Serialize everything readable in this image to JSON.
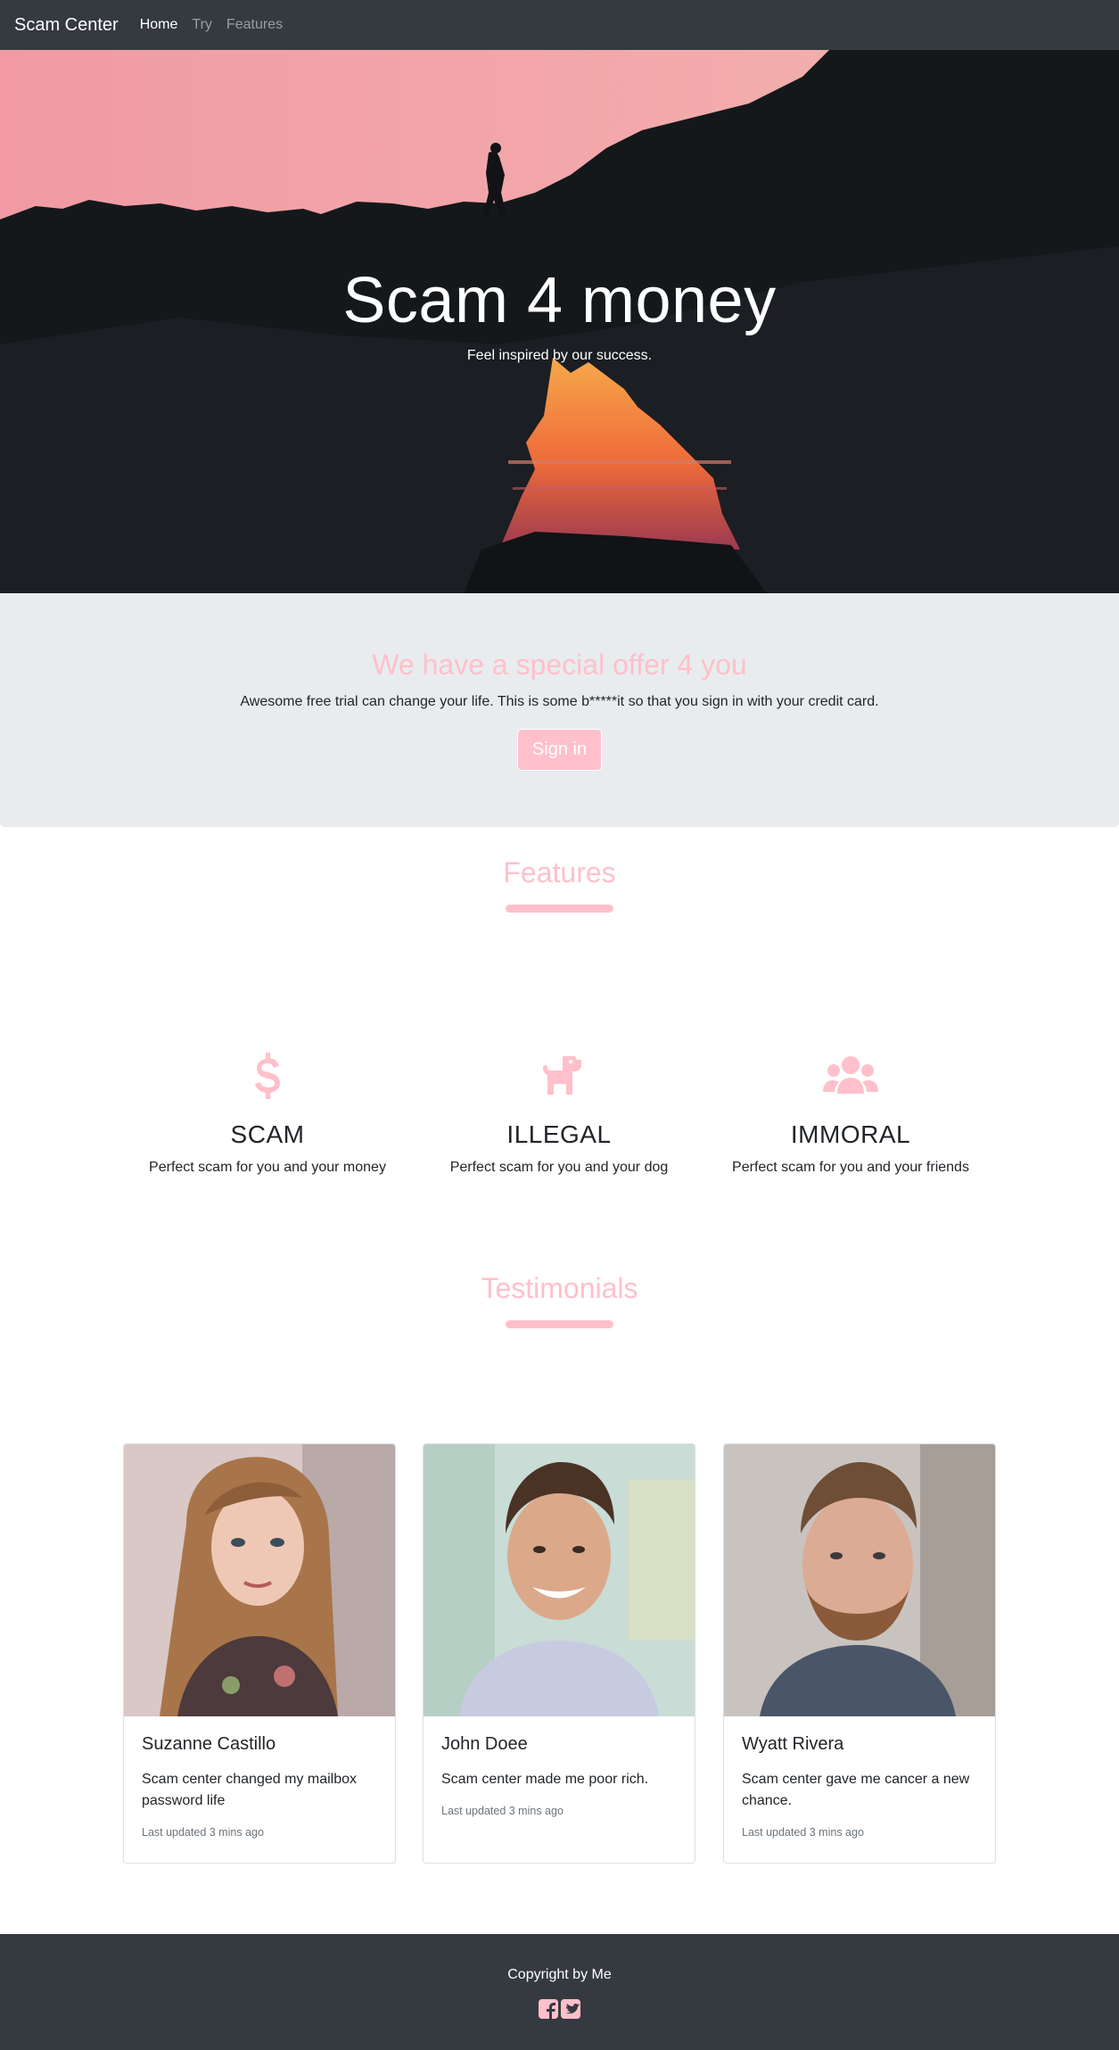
{
  "nav": {
    "brand": "Scam Center",
    "links": [
      "Home",
      "Try",
      "Features"
    ]
  },
  "hero": {
    "title": "Scam 4 money",
    "subtitle": "Feel inspired by our success."
  },
  "offer": {
    "title": "We have a special offer 4 you",
    "text": "Awesome free trial can change your life. This is some b*****it so that you sign in with your credit card.",
    "button": "Sign in"
  },
  "features": {
    "title": "Features",
    "items": [
      {
        "icon": "dollar-icon",
        "name": "SCAM",
        "text": "Perfect scam for you and your money"
      },
      {
        "icon": "dog-icon",
        "name": "ILLEGAL",
        "text": "Perfect scam for you and your dog"
      },
      {
        "icon": "users-icon",
        "name": "IMMORAL",
        "text": "Perfect scam for you and your friends"
      }
    ]
  },
  "testimonials": {
    "title": "Testimonials",
    "cards": [
      {
        "name": "Suzanne Castillo",
        "text": "Scam center changed my mailbox password life",
        "updated": "Last updated 3 mins ago"
      },
      {
        "name": "John Doee",
        "text": "Scam center made me poor rich.",
        "updated": "Last updated 3 mins ago"
      },
      {
        "name": "Wyatt Rivera",
        "text": "Scam center gave me cancer a new chance.",
        "updated": "Last updated 3 mins ago"
      }
    ]
  },
  "footer": {
    "text": "Copyright by Me",
    "social": [
      "facebook-icon",
      "twitter-icon"
    ]
  },
  "colors": {
    "accent": "#ffc0cb",
    "navbar": "#343a40",
    "offer_bg": "#e9ecef"
  }
}
